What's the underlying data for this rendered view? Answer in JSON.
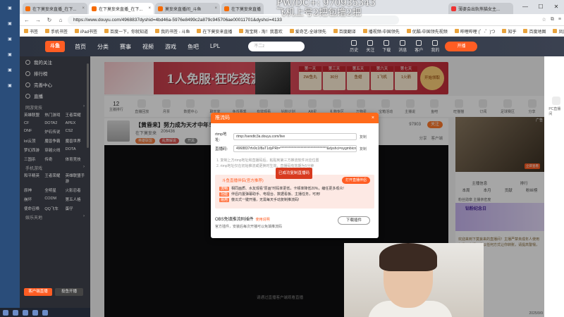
{
  "overlay": {
    "line1": "PW/DC+:  970935343",
    "line2": "飞机上号2把包撸2把"
  },
  "tabs": [
    {
      "label": "在下莫妄来直播_在下...",
      "active": false
    },
    {
      "label": "在下莫妄来直播_在下...",
      "active": true
    },
    {
      "label": "莫妄来直播间_斗鱼",
      "active": false
    },
    {
      "label": "在下莫妄来直播",
      "active": false
    }
  ],
  "browser_tabs_right": {
    "label": "薄婆会出轨熊猫女主..."
  },
  "address": {
    "url": "https://www.douyu.com/4968837dyshid=4bd46a-5976e8499c2a879c945706ae00011701&dyshci=4133"
  },
  "bookmarks": [
    "书签",
    "手机书签",
    "iPad书签",
    "百度一下，你就知道",
    "我的书签 - 斗鱼",
    "在下莫妄来直播",
    "淘宝网 - 淘！我喜欢",
    "爱奇艺-全球领先",
    "百度翻译",
    "播视频-中国领先",
    "优酷-中国领先视频",
    "哔哩哔哩 (゜-゜)つ",
    "知乎",
    "百度地图",
    "凤凰网 (凤凰新媒体)",
    "搜狐视频",
    "抢购商城 - PL频道",
    "斗鱼直播-斗鱼"
  ],
  "header": {
    "logo": "斗鱼",
    "nav": [
      "首页",
      "分类",
      "赛事",
      "视频",
      "游戏",
      "鱼吧",
      "LPL"
    ],
    "search_placeholder": "不二z",
    "right": [
      "历史",
      "关注",
      "下载",
      "消息",
      "客户",
      "我的"
    ],
    "live_btn": "开播"
  },
  "left_sidebar": {
    "items": [
      "我的关注",
      "排行榜",
      "完善中心",
      "直播"
    ],
    "section1": "网游竞技",
    "games": [
      "英雄联盟",
      "热门游戏",
      "王者荣耀",
      "CF",
      "DOTA2",
      "APEX",
      "DNF",
      "炉石传说",
      "CS2",
      "lol云顶",
      "魔兽争霸",
      "魔兽世界",
      "梦幻西游",
      "穿越火线",
      "DOTA",
      "三国杀",
      "传奇",
      "体育竞技"
    ],
    "section2": "手机游戏",
    "mobile": [
      "和平精英",
      "王者荣耀",
      "英雄联盟手游",
      "原神",
      "全明星",
      "火影忍者",
      "崩坏",
      "CODM",
      "第五人格",
      "使命召唤",
      "QQ飞车",
      "蛋仔"
    ],
    "section3": "娱乐天地",
    "btn_a": "客户端直播",
    "btn_b": "投鱼开播"
  },
  "banner": {
    "slogan": "1人免服·狂吃资源",
    "days": [
      {
        "d": "第一天",
        "p": "2W鱼丸"
      },
      {
        "d": "第三天",
        "p": "30分"
      },
      {
        "d": "第五天",
        "p": "鱼翅"
      },
      {
        "d": "第六天",
        "p": "1飞机"
      },
      {
        "d": "第七天",
        "p": "1火箭"
      }
    ],
    "cta": "开始领取"
  },
  "room_strip": {
    "rank_num": "12",
    "rank_label": "主播排行",
    "items": [
      "直播回放",
      "月票",
      "数据中心",
      "聊天室",
      "鱼币赛季",
      "有效观看",
      "钻粉计划",
      "AR星",
      "礼物专区",
      "万物星",
      "宝箱活动",
      "主播说",
      "鱼吧",
      "旺猫猫",
      "订阅",
      "足球赛区",
      "分享",
      "PC直播间"
    ]
  },
  "room": {
    "title": "【黄昏来】努力成为天才中年！",
    "streamer": "在下莫妄来",
    "fans": "206436",
    "hot": "97903",
    "tags": [
      "英雄联盟",
      "乱舞解说",
      "开黑"
    ],
    "follow": "关注",
    "share": "分享",
    "client": "客户端"
  },
  "player": {
    "hint": "请通过直播客户端观看直播"
  },
  "right_panel": {
    "ad_label": "广告",
    "ad_btn": "立即查看",
    "tabs1": [
      "主播信息",
      "排行"
    ],
    "tabs2": [
      "本周",
      "本月",
      "贡献",
      "粉丝榜"
    ],
    "note": "粉丝勋章 主播亲密度",
    "event_title": "钻粉纪念日",
    "chat": "欢迎来到下莫妄来的直播间！主播严禁未成年人使用打赏！主播不会以任何方式让你转账，请提高警惕，谨防诈骗。",
    "clock": "2025/9/9"
  },
  "dialog": {
    "title": "推流码",
    "rtmp_label": "rtmp地址:",
    "rtmp_value": "rtmp://sendtc3a.douyu.com/live",
    "key_label": "直播码:",
    "key_value": "4968837rfv9c1f8aT1dyPRt=**********************************&dyshci=sygmbicnv3",
    "copy": "复制",
    "step1": "1. 复制上方rtmp地址和直播码后，粘贴到第三方推流软件对应位置",
    "step2": "2. rtmp地址仅在初始推流或更换时生效，直播码有效期为5分钟",
    "copied": "已成功复制直播码",
    "tip_title": "斗鱼直播伴侣(官方推荐)",
    "open_btn": "打开直播伴侣",
    "lines": [
      {
        "tag": "流畅",
        "text": "相同画质、水友观看“原画”时码率更低，卡顿率降低20%，编任更多观众!"
      },
      {
        "tag": "功能",
        "text": "伴侣内置弹幕助手、电视台、数据看板、主播任务，可用!"
      },
      {
        "tag": "易用",
        "text": "傻瓜式一键开播，无需每天手动复制推流码!"
      }
    ],
    "obs_title": "OBS免填推流码插件",
    "obs_link": "使用说明",
    "obs_sub": "官方插件，安装后每次开播可以免填推流码",
    "download": "下载插件"
  }
}
